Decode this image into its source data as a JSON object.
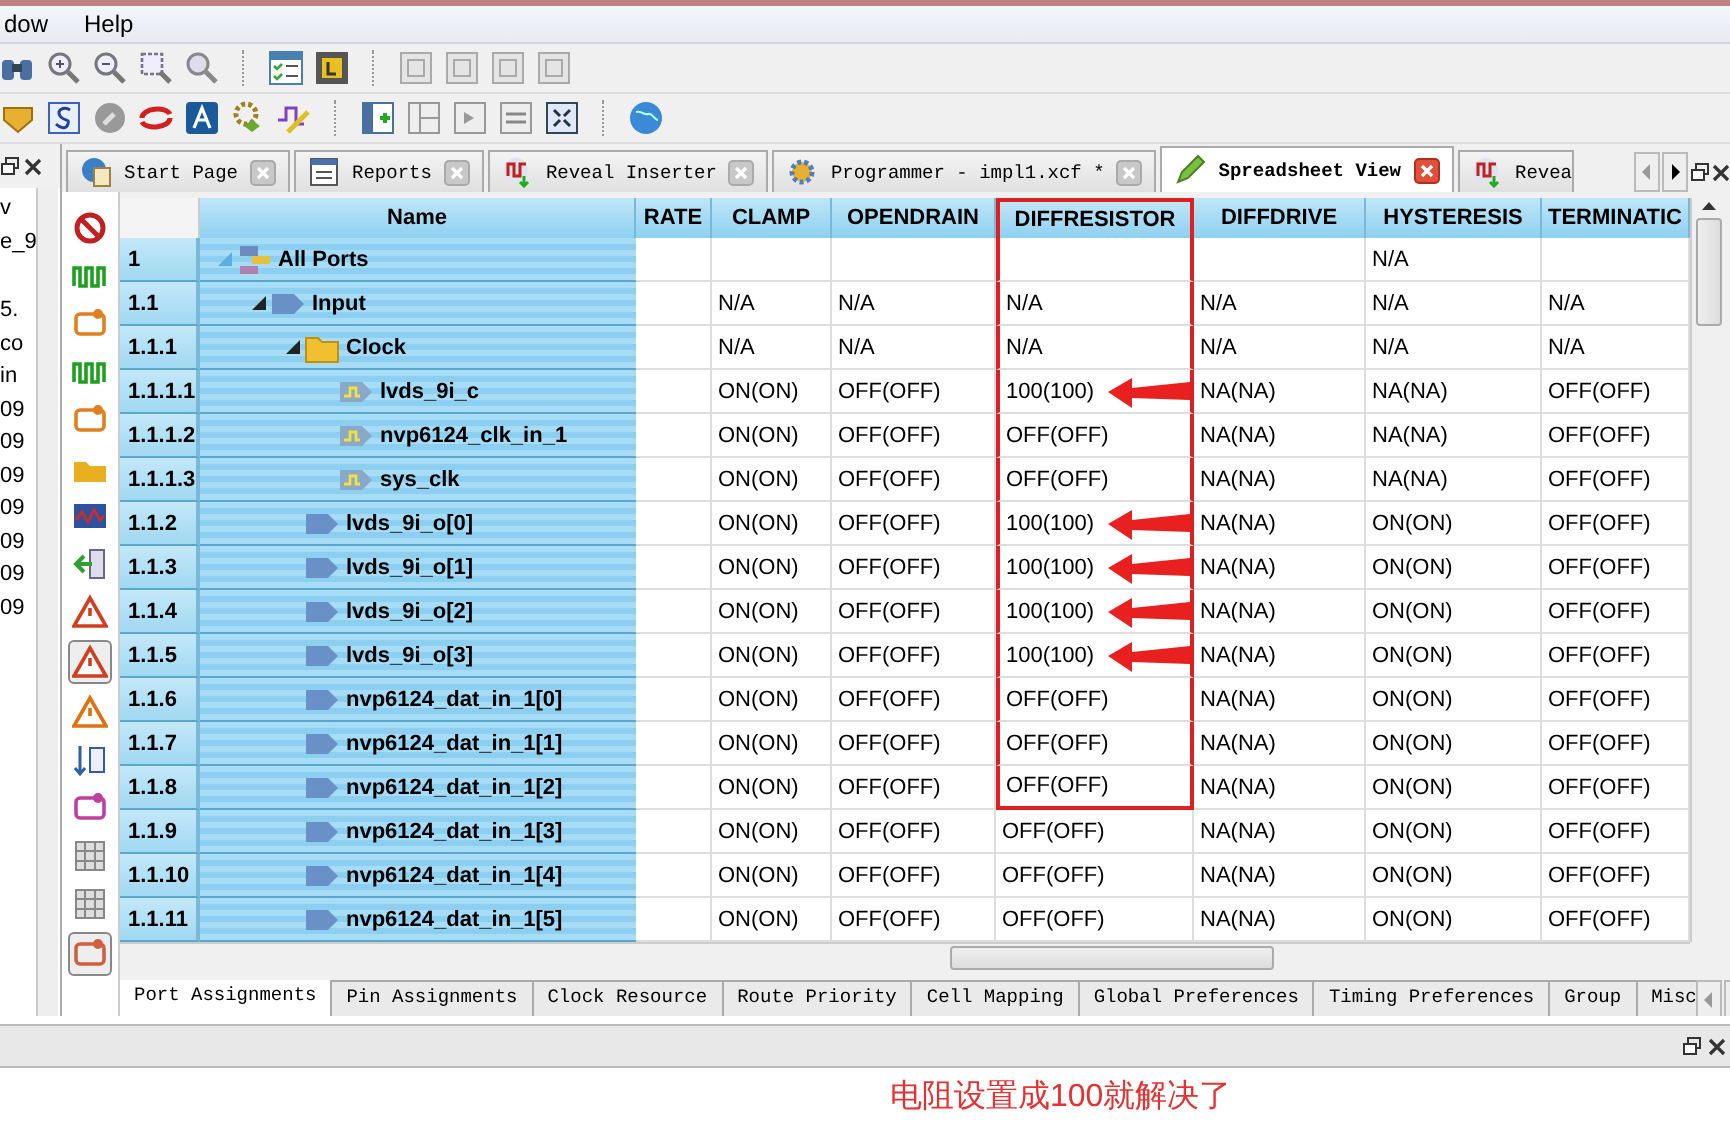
{
  "menu": [
    {
      "label": "dow"
    },
    {
      "label": "Help"
    }
  ],
  "left_panel": {
    "lines": [
      "v",
      "e_9",
      "5.",
      "co",
      "in",
      "09",
      "09",
      "09",
      "09",
      "09",
      "09",
      "09"
    ]
  },
  "editor_tabs": [
    {
      "label": "Start Page",
      "kind": "globe",
      "selected": false
    },
    {
      "label": "Reports",
      "kind": "report",
      "selected": false
    },
    {
      "label": "Reveal Inserter",
      "kind": "reveal",
      "selected": false
    },
    {
      "label": "Programmer - impl1.xcf *",
      "kind": "gear",
      "selected": false
    },
    {
      "label": "Spreadsheet View",
      "kind": "pencil",
      "selected": true
    },
    {
      "label": "Revea",
      "kind": "reveal",
      "selected": false
    }
  ],
  "table": {
    "name_column": {
      "label": "Name"
    },
    "columns": [
      {
        "label": "RATE",
        "highlighted": false
      },
      {
        "label": "CLAMP",
        "highlighted": false
      },
      {
        "label": "OPENDRAIN",
        "highlighted": false
      },
      {
        "label": "DIFFRESISTOR",
        "highlighted": true
      },
      {
        "label": "DIFFDRIVE",
        "highlighted": false
      },
      {
        "label": "HYSTERESIS",
        "highlighted": false
      },
      {
        "label": "TERMINATIC",
        "highlighted": false
      }
    ],
    "rows": [
      {
        "index": "1",
        "name": "All Ports",
        "kind": "root",
        "expanded": true,
        "boxed": true,
        "marked": false,
        "cells": [
          "",
          "",
          "",
          "",
          "",
          "N/A",
          ""
        ],
        "children": [
          {
            "index": "1.1",
            "name": "Input",
            "kind": "group",
            "expanded": true,
            "boxed": true,
            "marked": false,
            "cells": [
              null,
              "N/A",
              "N/A",
              "N/A",
              "N/A",
              "N/A",
              "N/A"
            ],
            "children": [
              {
                "index": "1.1.1",
                "name": "Clock",
                "kind": "folder",
                "expanded": true,
                "boxed": true,
                "marked": false,
                "cells": [
                  null,
                  "N/A",
                  "N/A",
                  "N/A",
                  "N/A",
                  "N/A",
                  "N/A"
                ],
                "children": [
                  {
                    "index": "1.1.1.1",
                    "name": "lvds_9i_c",
                    "kind": "clock",
                    "boxed": true,
                    "marked": true,
                    "cells": [
                      null,
                      "ON(ON)",
                      "OFF(OFF)",
                      "100(100)",
                      "NA(NA)",
                      "NA(NA)",
                      "OFF(OFF)"
                    ]
                  },
                  {
                    "index": "1.1.1.2",
                    "name": "nvp6124_clk_in_1",
                    "kind": "clock",
                    "boxed": true,
                    "marked": false,
                    "cells": [
                      null,
                      "ON(ON)",
                      "OFF(OFF)",
                      "OFF(OFF)",
                      "NA(NA)",
                      "NA(NA)",
                      "OFF(OFF)"
                    ]
                  },
                  {
                    "index": "1.1.1.3",
                    "name": "sys_clk",
                    "kind": "clock",
                    "boxed": true,
                    "marked": false,
                    "cells": [
                      null,
                      "ON(ON)",
                      "OFF(OFF)",
                      "OFF(OFF)",
                      "NA(NA)",
                      "NA(NA)",
                      "OFF(OFF)"
                    ]
                  }
                ]
              },
              {
                "index": "1.1.2",
                "name": "lvds_9i_o[0]",
                "kind": "port",
                "boxed": true,
                "marked": true,
                "cells": [
                  null,
                  "ON(ON)",
                  "OFF(OFF)",
                  "100(100)",
                  "NA(NA)",
                  "ON(ON)",
                  "OFF(OFF)"
                ]
              },
              {
                "index": "1.1.3",
                "name": "lvds_9i_o[1]",
                "kind": "port",
                "boxed": true,
                "marked": true,
                "cells": [
                  null,
                  "ON(ON)",
                  "OFF(OFF)",
                  "100(100)",
                  "NA(NA)",
                  "ON(ON)",
                  "OFF(OFF)"
                ]
              },
              {
                "index": "1.1.4",
                "name": "lvds_9i_o[2]",
                "kind": "port",
                "boxed": true,
                "marked": true,
                "cells": [
                  null,
                  "ON(ON)",
                  "OFF(OFF)",
                  "100(100)",
                  "NA(NA)",
                  "ON(ON)",
                  "OFF(OFF)"
                ]
              },
              {
                "index": "1.1.5",
                "name": "lvds_9i_o[3]",
                "kind": "port",
                "boxed": true,
                "marked": true,
                "cells": [
                  null,
                  "ON(ON)",
                  "OFF(OFF)",
                  "100(100)",
                  "NA(NA)",
                  "ON(ON)",
                  "OFF(OFF)"
                ]
              },
              {
                "index": "1.1.6",
                "name": "nvp6124_dat_in_1[0]",
                "kind": "port",
                "boxed": true,
                "marked": false,
                "cells": [
                  null,
                  "ON(ON)",
                  "OFF(OFF)",
                  "OFF(OFF)",
                  "NA(NA)",
                  "ON(ON)",
                  "OFF(OFF)"
                ]
              },
              {
                "index": "1.1.7",
                "name": "nvp6124_dat_in_1[1]",
                "kind": "port",
                "boxed": true,
                "marked": false,
                "cells": [
                  null,
                  "ON(ON)",
                  "OFF(OFF)",
                  "OFF(OFF)",
                  "NA(NA)",
                  "ON(ON)",
                  "OFF(OFF)"
                ]
              },
              {
                "index": "1.1.8",
                "name": "nvp6124_dat_in_1[2]",
                "kind": "port",
                "boxed": true,
                "marked": false,
                "cells": [
                  null,
                  "ON(ON)",
                  "OFF(OFF)",
                  "OFF(OFF)",
                  "NA(NA)",
                  "ON(ON)",
                  "OFF(OFF)"
                ]
              },
              {
                "index": "1.1.9",
                "name": "nvp6124_dat_in_1[3]",
                "kind": "port",
                "boxed": false,
                "marked": false,
                "cells": [
                  null,
                  "ON(ON)",
                  "OFF(OFF)",
                  "OFF(OFF)",
                  "NA(NA)",
                  "ON(ON)",
                  "OFF(OFF)"
                ]
              },
              {
                "index": "1.1.10",
                "name": "nvp6124_dat_in_1[4]",
                "kind": "port",
                "boxed": false,
                "marked": false,
                "cells": [
                  null,
                  "ON(ON)",
                  "OFF(OFF)",
                  "OFF(OFF)",
                  "NA(NA)",
                  "ON(ON)",
                  "OFF(OFF)"
                ]
              },
              {
                "index": "1.1.11",
                "name": "nvp6124_dat_in_1[5]",
                "kind": "port",
                "boxed": false,
                "marked": false,
                "cells": [
                  null,
                  "ON(ON)",
                  "OFF(OFF)",
                  "OFF(OFF)",
                  "NA(NA)",
                  "ON(ON)",
                  "OFF(OFF)"
                ]
              }
            ]
          }
        ]
      }
    ]
  },
  "bottom_tabs": [
    {
      "label": "Port Assignments",
      "selected": true
    },
    {
      "label": "Pin Assignments",
      "selected": false
    },
    {
      "label": "Clock Resource",
      "selected": false
    },
    {
      "label": "Route Priority",
      "selected": false
    },
    {
      "label": "Cell Mapping",
      "selected": false
    },
    {
      "label": "Global Preferences",
      "selected": false
    },
    {
      "label": "Timing Preferences",
      "selected": false
    },
    {
      "label": "Group",
      "selected": false
    },
    {
      "label": "Misc",
      "selected": false
    }
  ],
  "note": "电阻设置成100就解决了"
}
